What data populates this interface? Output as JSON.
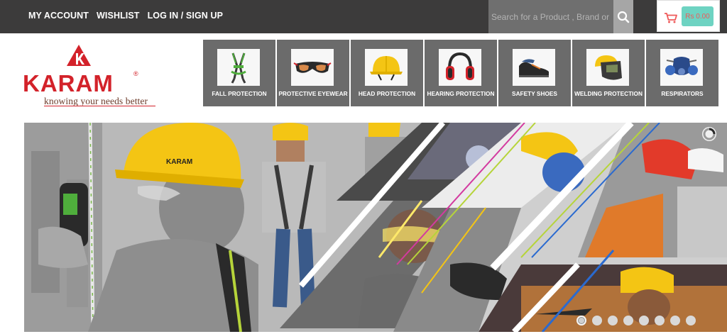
{
  "topnav": {
    "my_account": "MY ACCOUNT",
    "wishlist": "WISHLIST",
    "login": "LOG IN / SIGN UP"
  },
  "search": {
    "placeholder": "Search for a Product , Brand or Category"
  },
  "cart": {
    "price": "Rs 0.00"
  },
  "brand": {
    "name": "KARAM",
    "reg": "®",
    "tagline": "knowing your needs better",
    "color": "#d3222a"
  },
  "categories": [
    {
      "label": "FALL PROTECTION",
      "icon": "harness-icon"
    },
    {
      "label": "PROTECTIVE EYEWEAR",
      "icon": "goggles-icon"
    },
    {
      "label": "HEAD PROTECTION",
      "icon": "helmet-icon"
    },
    {
      "label": "HEARING PROTECTION",
      "icon": "earmuff-icon"
    },
    {
      "label": "SAFETY SHOES",
      "icon": "shoe-icon"
    },
    {
      "label": "WELDING PROTECTION",
      "icon": "welding-shield-icon"
    },
    {
      "label": "RESPIRATORS",
      "icon": "respirator-icon"
    }
  ],
  "slider": {
    "active_index": 0,
    "total": 8
  },
  "colors": {
    "topbar": "#3c3b3b",
    "tile": "#6b6b6b",
    "cart_badge": "#6ed3c2",
    "helmet_yellow": "#f4c514"
  }
}
